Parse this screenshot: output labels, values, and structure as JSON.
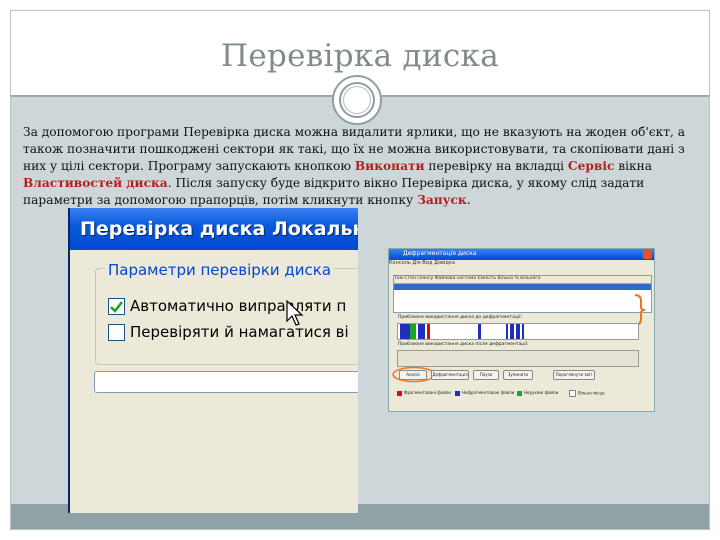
{
  "slide": {
    "title": "Перевірка диска",
    "paragraph": {
      "t1": "За допомогою програми Перевірка диска можна видалити ярлики, що не вказують на жоден об'єкт, а також позначити пошкоджені сектори як такі, що їх не можна використовувати, та скопіювати дані з них у цілі сектори. Програму запускають кнопкою ",
      "h1": "Виконати",
      "t2": " перевірку на вкладці ",
      "h2": "Сервіс",
      "t3": " вікна ",
      "h3": "Властивостей диска",
      "t4": ". Після запуску буде відкрито вікно Перевірка диска, у якому слід задати параметри за допомогою прапорців, потім кликнути кнопку ",
      "h4": "Запуск",
      "t5": "."
    }
  },
  "dialog_zoom": {
    "title": "Перевірка диска Локальни",
    "group_title": "Параметри перевірки диска",
    "option1": "Автоматично виправляти п",
    "option1_checked": true,
    "option2": "Перевіряти й намагатися ві",
    "option2_checked": false
  },
  "defrag_window": {
    "title": "Дефрагментація диска",
    "menu": "Консоль   Дія   Вид   Довідка",
    "columns": "Том      Стан сеансу      Файлова система      Ємність      Вільно      % вільного",
    "row1": "(C:)",
    "label_before": "Приблизне використання диска до дефрагментації:",
    "label_after": "Приблизне використання диска після дефрагментації:",
    "buttons": [
      "Аналіз",
      "Дефрагментація",
      "Пауза",
      "Зупинити",
      "Переглянути звіт"
    ],
    "legend": [
      "Фрагментовані файли",
      "Нефрагментовані файли",
      "Нерухомі файли",
      "Вільне місце"
    ],
    "colors": {
      "fragmented": "#d01010",
      "contiguous": "#1c2fbf",
      "unmovable": "#1aa52a",
      "free": "#ffffff",
      "highlight": "#e87722"
    }
  }
}
